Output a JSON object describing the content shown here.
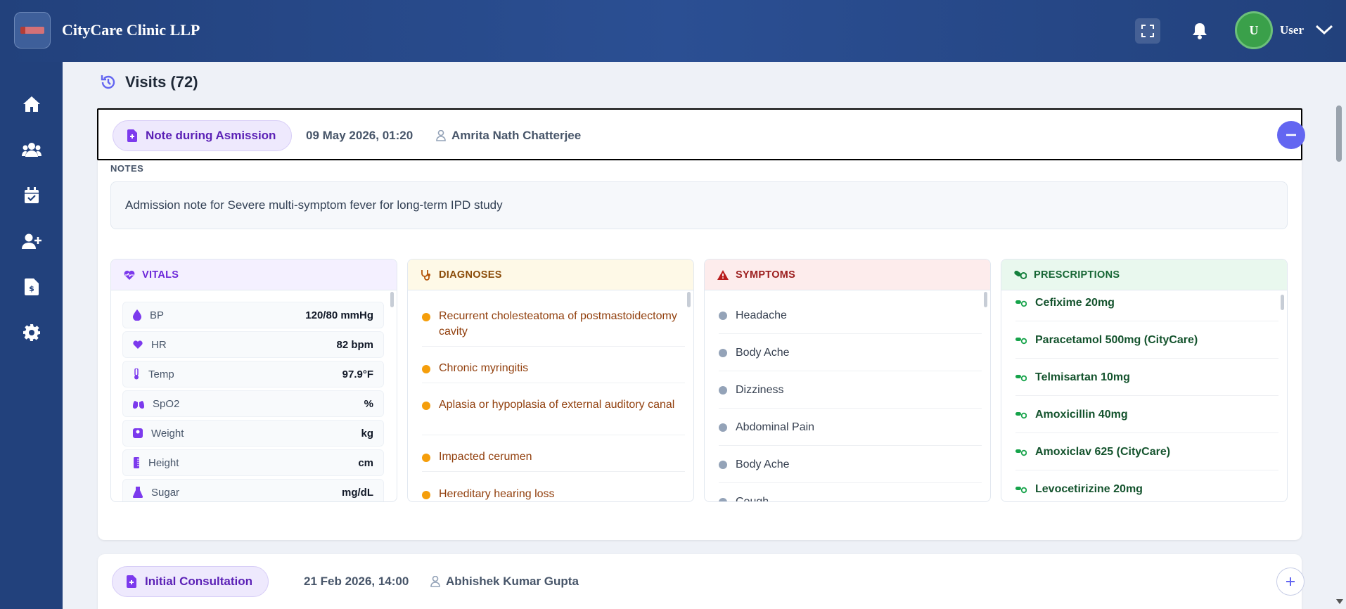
{
  "app": {
    "brand": "CityCare Clinic LLP",
    "user_label": "User",
    "user_initial": "U"
  },
  "sidebar": {
    "items": [
      {
        "name": "home-icon"
      },
      {
        "name": "users-icon"
      },
      {
        "name": "calendar-check-icon"
      },
      {
        "name": "user-plus-icon"
      },
      {
        "name": "invoice-icon"
      },
      {
        "name": "gear-icon"
      }
    ]
  },
  "section": {
    "title": "Visits (72)"
  },
  "visits": [
    {
      "type": "Note during Asmission",
      "date": "09 May 2026, 01:20",
      "doctor": "Amrita Nath Chatterjee",
      "notes_label": "NOTES",
      "notes": "Admission note for Severe multi-symptom fever for long-term IPD study",
      "vitals_title": "VITALS",
      "vitals": [
        {
          "label": "BP",
          "value": "120/80 mmHg",
          "icon": "drop-icon"
        },
        {
          "label": "HR",
          "value": "82 bpm",
          "icon": "heart-icon"
        },
        {
          "label": "Temp",
          "value": "97.9°F",
          "icon": "thermometer-icon"
        },
        {
          "label": "SpO2",
          "value": "%",
          "icon": "lungs-icon"
        },
        {
          "label": "Weight",
          "value": "kg",
          "icon": "weight-icon"
        },
        {
          "label": "Height",
          "value": "cm",
          "icon": "ruler-icon"
        },
        {
          "label": "Sugar",
          "value": "mg/dL",
          "icon": "flask-icon"
        }
      ],
      "diagnoses_title": "DIAGNOSES",
      "diagnoses": [
        "Recurrent cholesteatoma of postmastoidectomy cavity",
        "Chronic myringitis",
        "Aplasia or hypoplasia of external auditory canal",
        "Impacted cerumen",
        "Hereditary hearing loss"
      ],
      "symptoms_title": "SYMPTOMS",
      "symptoms": [
        "Headache",
        "Body Ache",
        "Dizziness",
        "Abdominal Pain",
        "Body Ache",
        "Cough"
      ],
      "prescriptions_title": "PRESCRIPTIONS",
      "prescriptions": [
        "Cefixime 20mg",
        "Paracetamol 500mg (CityCare)",
        "Telmisartan 10mg",
        "Amoxicillin 40mg",
        "Amoxiclav 625 (CityCare)",
        "Levocetirizine 20mg"
      ]
    },
    {
      "type": "Initial Consultation",
      "date": "21 Feb 2026, 14:00",
      "doctor": "Abhishek Kumar Gupta"
    }
  ],
  "colors": {
    "accent": "#6366f1",
    "topbar": "#22417c",
    "diag_dot": "#f59e0b",
    "sym_dot": "#94a3b8",
    "rx": "#16a34a"
  }
}
